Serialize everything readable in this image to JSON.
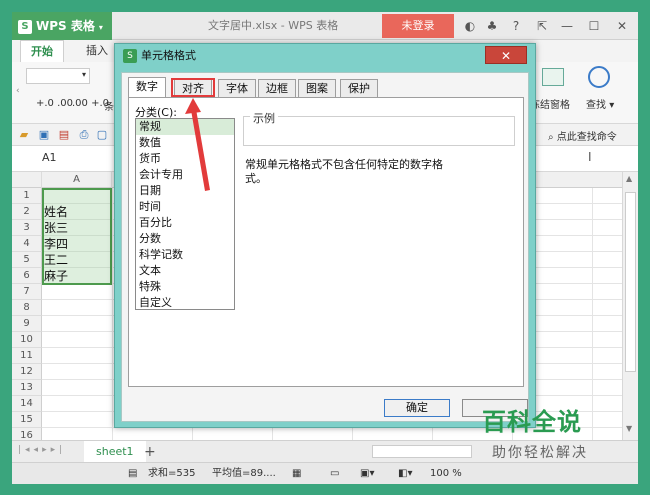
{
  "app": {
    "menu_label": "WPS 表格",
    "document_title": "文字居中.xlsx - WPS 表格",
    "login_label": "未登录"
  },
  "ribbon": {
    "tabs": [
      "开始",
      "插入"
    ],
    "format_btn": "条",
    "freeze_label": "冻结窗格",
    "find_label": "查找",
    "find_cmd": "点此查找命令",
    "decimal_inc": "+.0 .00",
    "decimal_dec": ".00 +.0"
  },
  "formula_bar": {
    "name_box": "A1"
  },
  "grid": {
    "columns": [
      "A"
    ],
    "rows": [
      "1",
      "2",
      "3",
      "4",
      "5",
      "6",
      "7",
      "8",
      "9",
      "10",
      "11",
      "12",
      "13",
      "14",
      "15",
      "16"
    ],
    "cells": [
      "姓名",
      "张三",
      "李四",
      "王二",
      "麻子"
    ]
  },
  "sheets": {
    "active": "sheet1",
    "add": "+"
  },
  "status": {
    "sum": "求和=535",
    "avg": "平均值=89....",
    "zoom": "100 %"
  },
  "dialog": {
    "title": "单元格格式",
    "close": "✕",
    "tabs": [
      "数字",
      "对齐",
      "字体",
      "边框",
      "图案",
      "保护"
    ],
    "category_label": "分类(C):",
    "categories": [
      "常规",
      "数值",
      "货币",
      "会计专用",
      "日期",
      "时间",
      "百分比",
      "分数",
      "科学记数",
      "文本",
      "特殊",
      "自定义"
    ],
    "sample_label": "示例",
    "description": "常规单元格格式不包含任何特定的数字格式。",
    "ok": "确定"
  },
  "watermark": {
    "main": "百科全说",
    "sub": "助你轻松解决"
  },
  "colors": {
    "accent": "#2a9b51",
    "highlight": "#e23b3b",
    "dialog_frame": "#7fd0c9",
    "login": "#e9675b"
  }
}
